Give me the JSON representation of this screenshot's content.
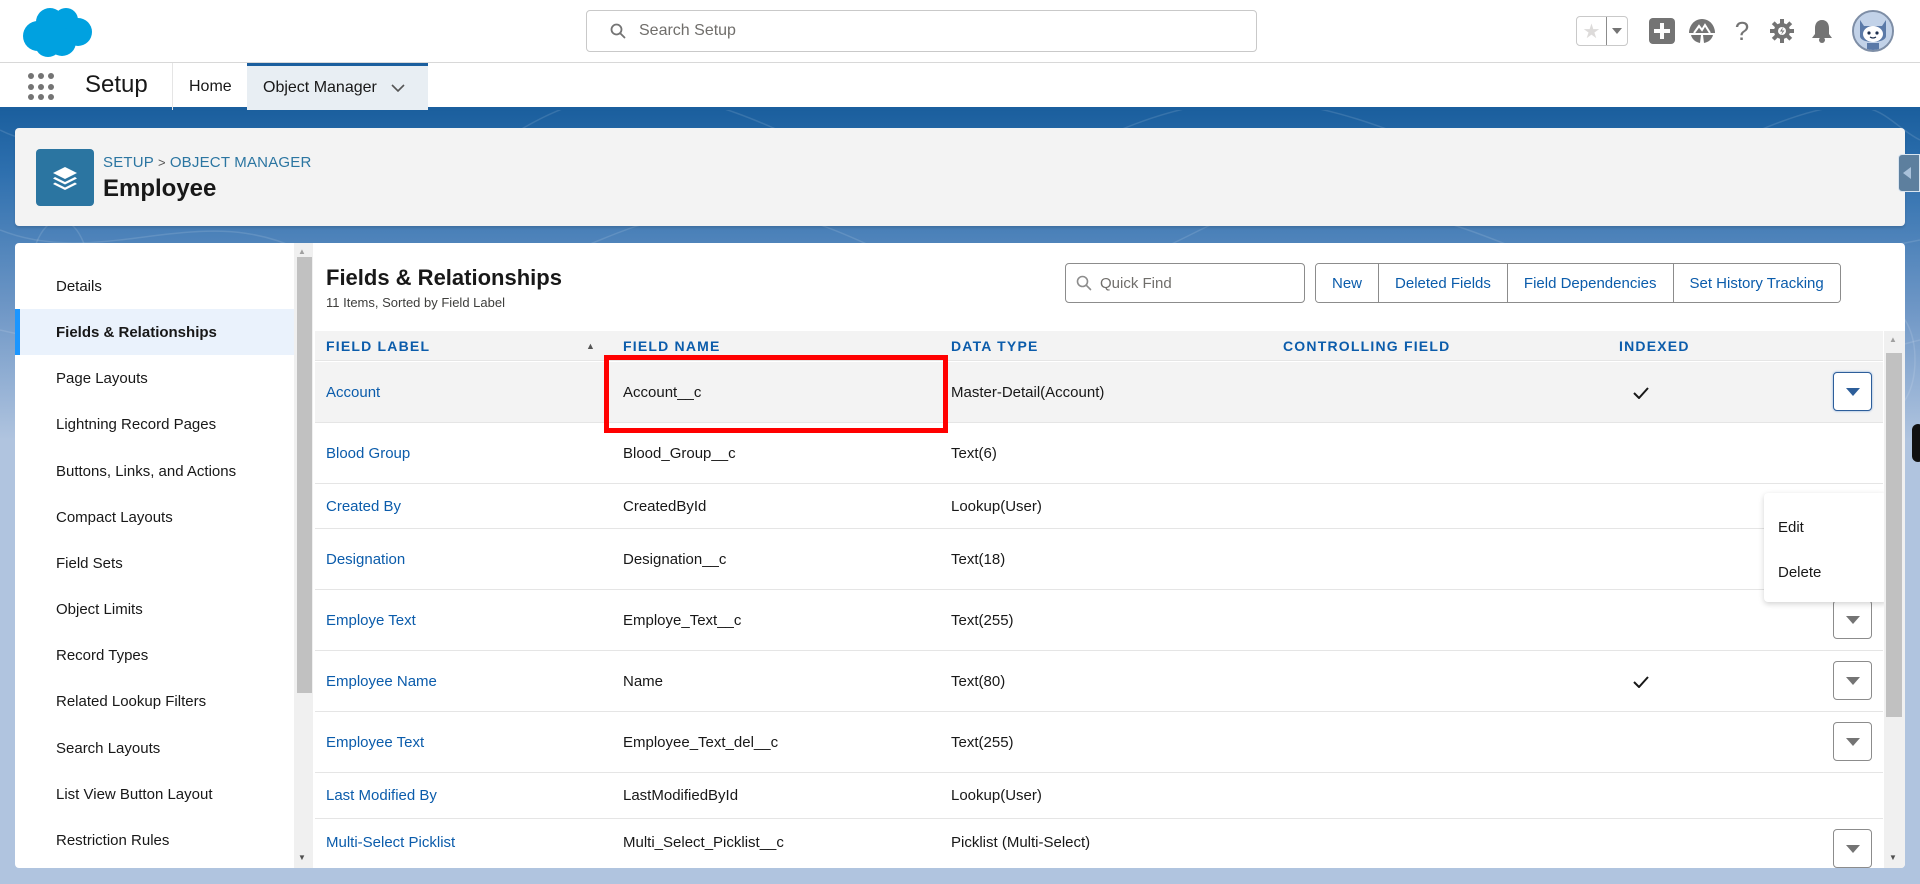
{
  "header": {
    "search_placeholder": "Search Setup",
    "icons": [
      "favorites-star-icon",
      "favorites-dropdown-icon",
      "global-actions-add-icon",
      "trailhead-icon",
      "help-icon",
      "setup-gear-icon",
      "notifications-bell-icon",
      "user-avatar"
    ]
  },
  "context_bar": {
    "app_name": "Setup",
    "tabs": [
      {
        "label": "Home",
        "active": false
      },
      {
        "label": "Object Manager",
        "active": true
      }
    ]
  },
  "object_header": {
    "breadcrumb": [
      "SETUP",
      "OBJECT MANAGER"
    ],
    "breadcrumb_separator": ">",
    "title": "Employee",
    "icon": "layers-icon"
  },
  "left_nav": {
    "items": [
      {
        "label": "Details",
        "active": false
      },
      {
        "label": "Fields & Relationships",
        "active": true
      },
      {
        "label": "Page Layouts",
        "active": false
      },
      {
        "label": "Lightning Record Pages",
        "active": false
      },
      {
        "label": "Buttons, Links, and Actions",
        "active": false
      },
      {
        "label": "Compact Layouts",
        "active": false
      },
      {
        "label": "Field Sets",
        "active": false
      },
      {
        "label": "Object Limits",
        "active": false
      },
      {
        "label": "Record Types",
        "active": false
      },
      {
        "label": "Related Lookup Filters",
        "active": false
      },
      {
        "label": "Search Layouts",
        "active": false
      },
      {
        "label": "List View Button Layout",
        "active": false
      },
      {
        "label": "Restriction Rules",
        "active": false
      }
    ]
  },
  "content": {
    "title": "Fields & Relationships",
    "subtitle": "11 Items, Sorted by Field Label",
    "quick_find_placeholder": "Quick Find",
    "buttons": [
      "New",
      "Deleted Fields",
      "Field Dependencies",
      "Set History Tracking"
    ],
    "columns": [
      "FIELD LABEL",
      "FIELD NAME",
      "DATA TYPE",
      "CONTROLLING FIELD",
      "INDEXED"
    ],
    "sort": {
      "column": "FIELD LABEL",
      "direction": "ascending"
    },
    "rows": [
      {
        "label": "Account",
        "name": "Account__c",
        "type": "Master-Detail(Account)",
        "controlling": "",
        "indexed": true,
        "has_action": true
      },
      {
        "label": "Blood Group",
        "name": "Blood_Group__c",
        "type": "Text(6)",
        "controlling": "",
        "indexed": false,
        "has_action": true
      },
      {
        "label": "Created By",
        "name": "CreatedById",
        "type": "Lookup(User)",
        "controlling": "",
        "indexed": false,
        "has_action": false
      },
      {
        "label": "Designation",
        "name": "Designation__c",
        "type": "Text(18)",
        "controlling": "",
        "indexed": false,
        "has_action": true
      },
      {
        "label": "Employe Text",
        "name": "Employe_Text__c",
        "type": "Text(255)",
        "controlling": "",
        "indexed": false,
        "has_action": true
      },
      {
        "label": "Employee Name",
        "name": "Name",
        "type": "Text(80)",
        "controlling": "",
        "indexed": true,
        "has_action": true
      },
      {
        "label": "Employee Text",
        "name": "Employee_Text_del__c",
        "type": "Text(255)",
        "controlling": "",
        "indexed": false,
        "has_action": true
      },
      {
        "label": "Last Modified By",
        "name": "LastModifiedById",
        "type": "Lookup(User)",
        "controlling": "",
        "indexed": false,
        "has_action": false
      },
      {
        "label": "Multi-Select Picklist",
        "name": "Multi_Select_Picklist__c",
        "type": "Picklist (Multi-Select)",
        "controlling": "",
        "indexed": false,
        "has_action": true
      }
    ],
    "row_menu": {
      "open_for_row": "Account",
      "items": [
        "Edit",
        "Delete"
      ]
    },
    "highlighted_cell": {
      "row": "Account",
      "column": "FIELD NAME",
      "color": "#ff0000"
    }
  },
  "colors": {
    "brand_blue": "#0b5cab",
    "header_band": "#1b5f9e",
    "object_icon": "#2b75a1",
    "salesforce_cloud": "#00a1e0",
    "active_nav_accent": "#1b96ff"
  }
}
